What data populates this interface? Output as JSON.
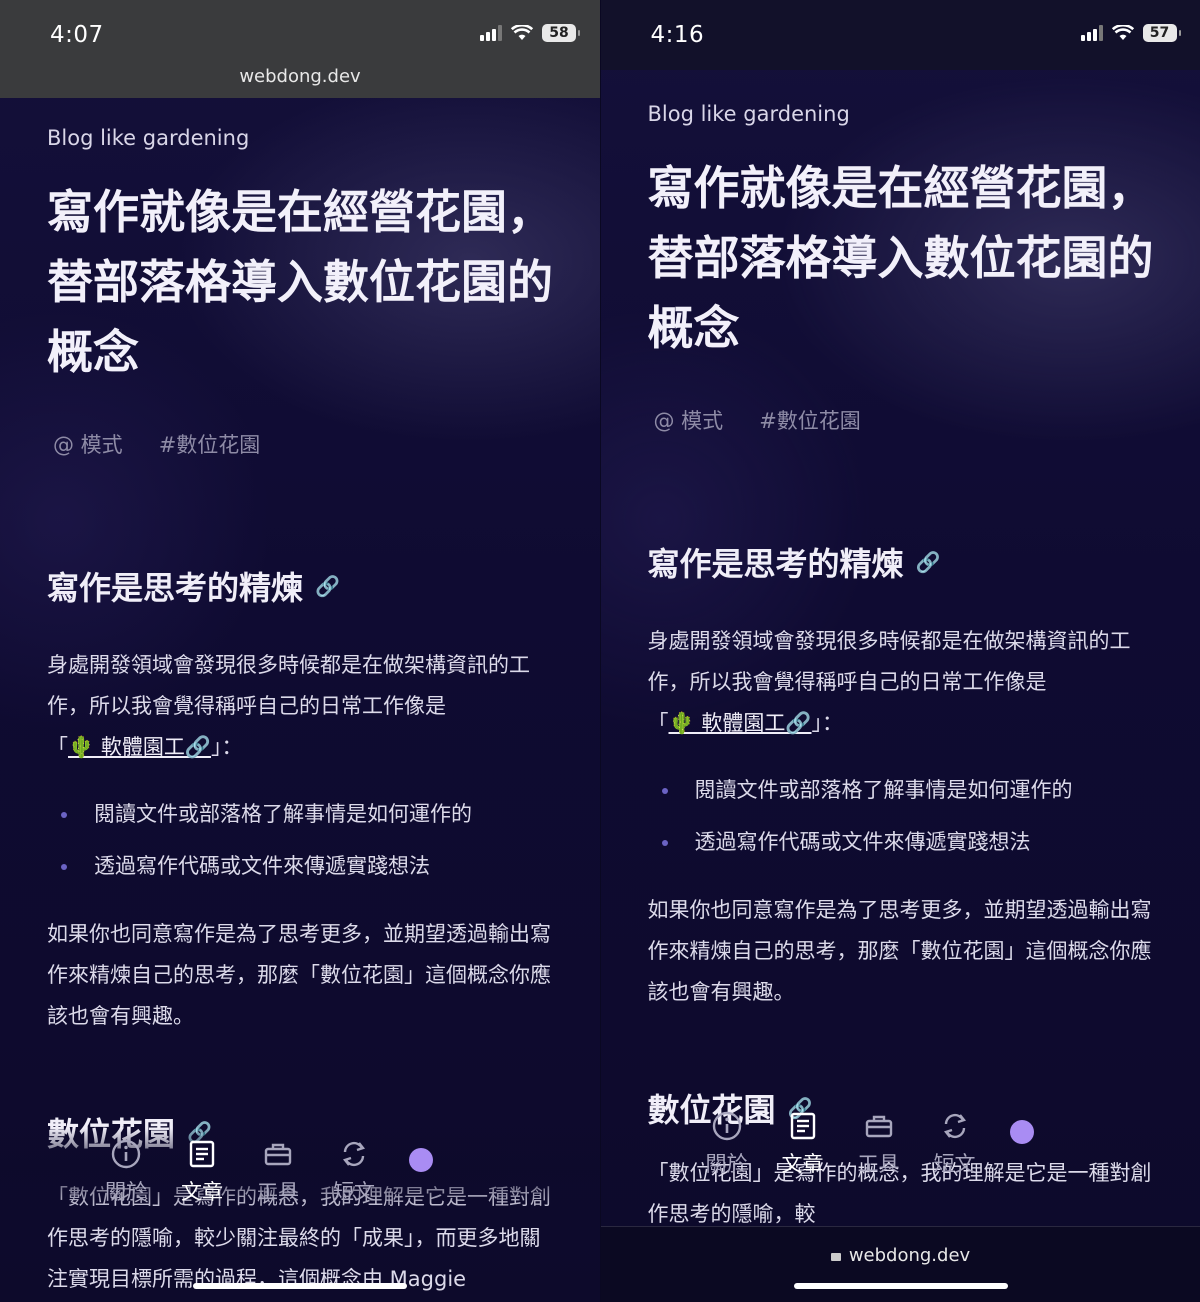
{
  "screens": [
    {
      "time": "4:07",
      "battery": "58",
      "url": "webdong.dev"
    },
    {
      "time": "4:16",
      "battery": "57",
      "url": "webdong.dev"
    }
  ],
  "article": {
    "subtitle": "Blog like gardening",
    "title": "寫作就像是在經營花園，替部落格導入數位花園的概念",
    "tags": [
      "@ 模式",
      "#數位花園"
    ],
    "section1": {
      "heading": "寫作是思考的精煉",
      "p1_text": "身處開發領域會發現很多時候都是在做架構資訊的工作，所以我會覺得稱呼自己的日常工作像是",
      "p1_quote_open": "「",
      "p1_link": "🌵 軟體園工🔗",
      "p1_quote_close": "」：",
      "bullets": [
        "閱讀文件或部落格了解事情是如何運作的",
        "透過寫作代碼或文件來傳遞實踐想法"
      ],
      "p2": "如果你也同意寫作是為了思考更多，並期望透過輸出寫作來精煉自己的思考，那麼「數位花園」這個概念你應該也會有興趣。"
    },
    "section2": {
      "heading": "數位花園",
      "p_left": "「數位花園」是寫作的概念，我的理解是它是一種對創作思考的隱喻，較少關注最終的「成果」，而更多地關注實現目標所需的過程，這個概念由 Maggie Appleton",
      "p_right": "「數位花園」是寫作的概念，我的理解是它是一種對創作思考的隱喻，較"
    }
  },
  "tabbar": [
    {
      "label": "關於",
      "icon": "info-icon"
    },
    {
      "label": "文章",
      "icon": "article-icon"
    },
    {
      "label": "工具",
      "icon": "toolbox-icon"
    },
    {
      "label": "短文",
      "icon": "repeat-icon"
    }
  ],
  "colors": {
    "accent": "#a98cf3",
    "background": "#0d0a2b",
    "bullet": "#6b63c4"
  }
}
